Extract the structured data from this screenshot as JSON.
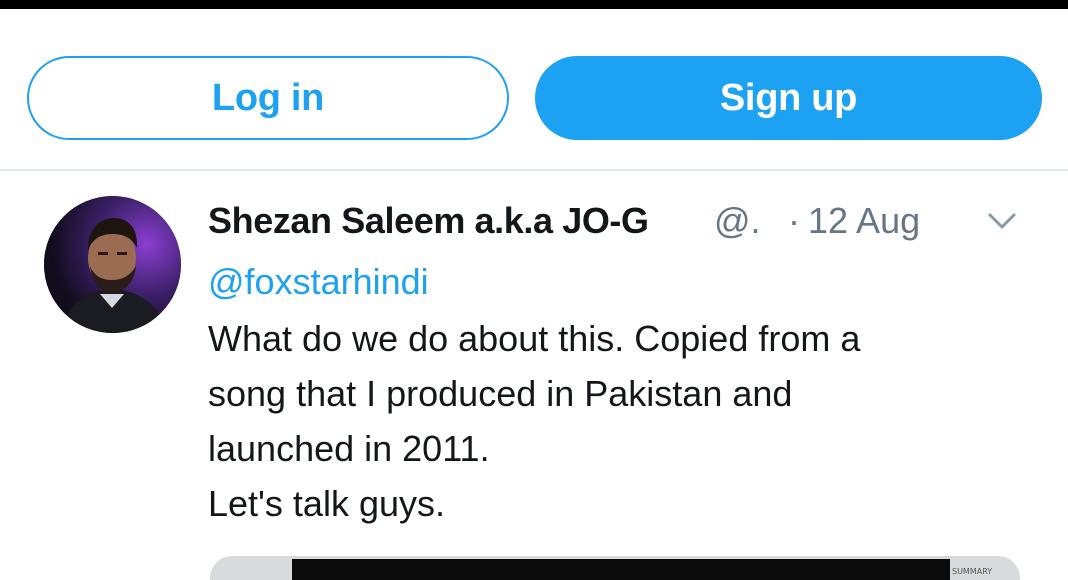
{
  "auth": {
    "login_label": "Log in",
    "signup_label": "Sign up"
  },
  "tweet": {
    "author_name": "Shezan Saleem a.k.a JO-G",
    "handle": "@.",
    "separator": "·",
    "date": "12 Aug",
    "reply_to": "@foxstarhindi",
    "body_lines": [
      "What do we do about this. Copied from a",
      "song that I produced in Pakistan and",
      "launched in 2011.",
      "Let's talk guys."
    ],
    "media_tag": "SUMMARY"
  },
  "icons": {
    "menu": "chevron-down-icon",
    "avatar": "avatar"
  },
  "colors": {
    "accent": "#1da1f2",
    "secondary_text": "#657786",
    "divider": "#e1e8ed",
    "status_bar": "#000000"
  }
}
